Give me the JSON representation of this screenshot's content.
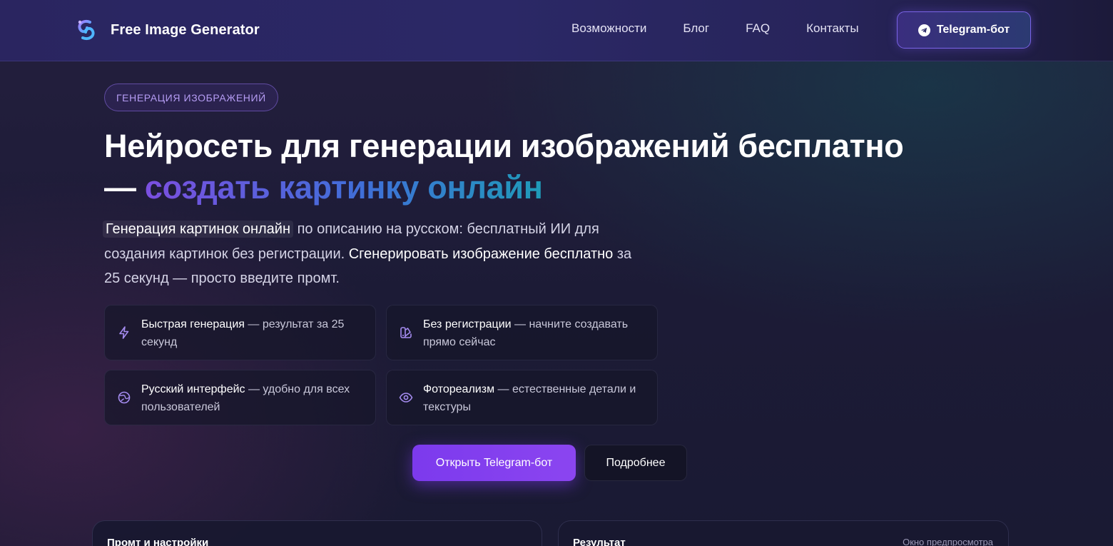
{
  "nav": {
    "brand": "Free Image Generator",
    "links": [
      "Возможности",
      "Блог",
      "FAQ",
      "Контакты"
    ],
    "cta": "Telegram-бот"
  },
  "hero": {
    "badge": "ГЕНЕРАЦИЯ ИЗОБРАЖЕНИЙ",
    "title_main": "Нейросеть для генерации изображений бесплатно",
    "title_dash": "— ",
    "title_accent": "создать картинку онлайн",
    "desc": {
      "hl1": "Генерация картинок онлайн",
      "t1": " по описанию на русском: бесплатный ИИ для создания картинок без регистрации. ",
      "hl2": "Сгенерировать изображение бесплатно",
      "t2": " за 25 секунд — просто введите промт."
    }
  },
  "features": [
    {
      "title": "Быстрая генерация",
      "text": " — результат за 25 секунд",
      "icon": "lightning-icon"
    },
    {
      "title": "Без регистрации",
      "text": " — начните создавать прямо сейчас",
      "icon": "palette-icon"
    },
    {
      "title": "Русский интерфейс",
      "text": " — удобно для всех пользователей",
      "icon": "globe-icon"
    },
    {
      "title": "Фотореализм",
      "text": " — естественные детали и текстуры",
      "icon": "eye-icon"
    }
  ],
  "cta": {
    "primary": "Открыть Telegram-бот",
    "secondary": "Подробнее"
  },
  "panels": {
    "left_title": "Промт и настройки",
    "right_title": "Результат",
    "right_sub": "Окно предпросмотра"
  },
  "colors": {
    "accent_purple": "#7c3aed",
    "accent_gradient_start": "#7b4fe0",
    "accent_gradient_end": "#1f9bb8",
    "badge_text": "#b59cf4",
    "icon_color": "#a58cf0"
  }
}
